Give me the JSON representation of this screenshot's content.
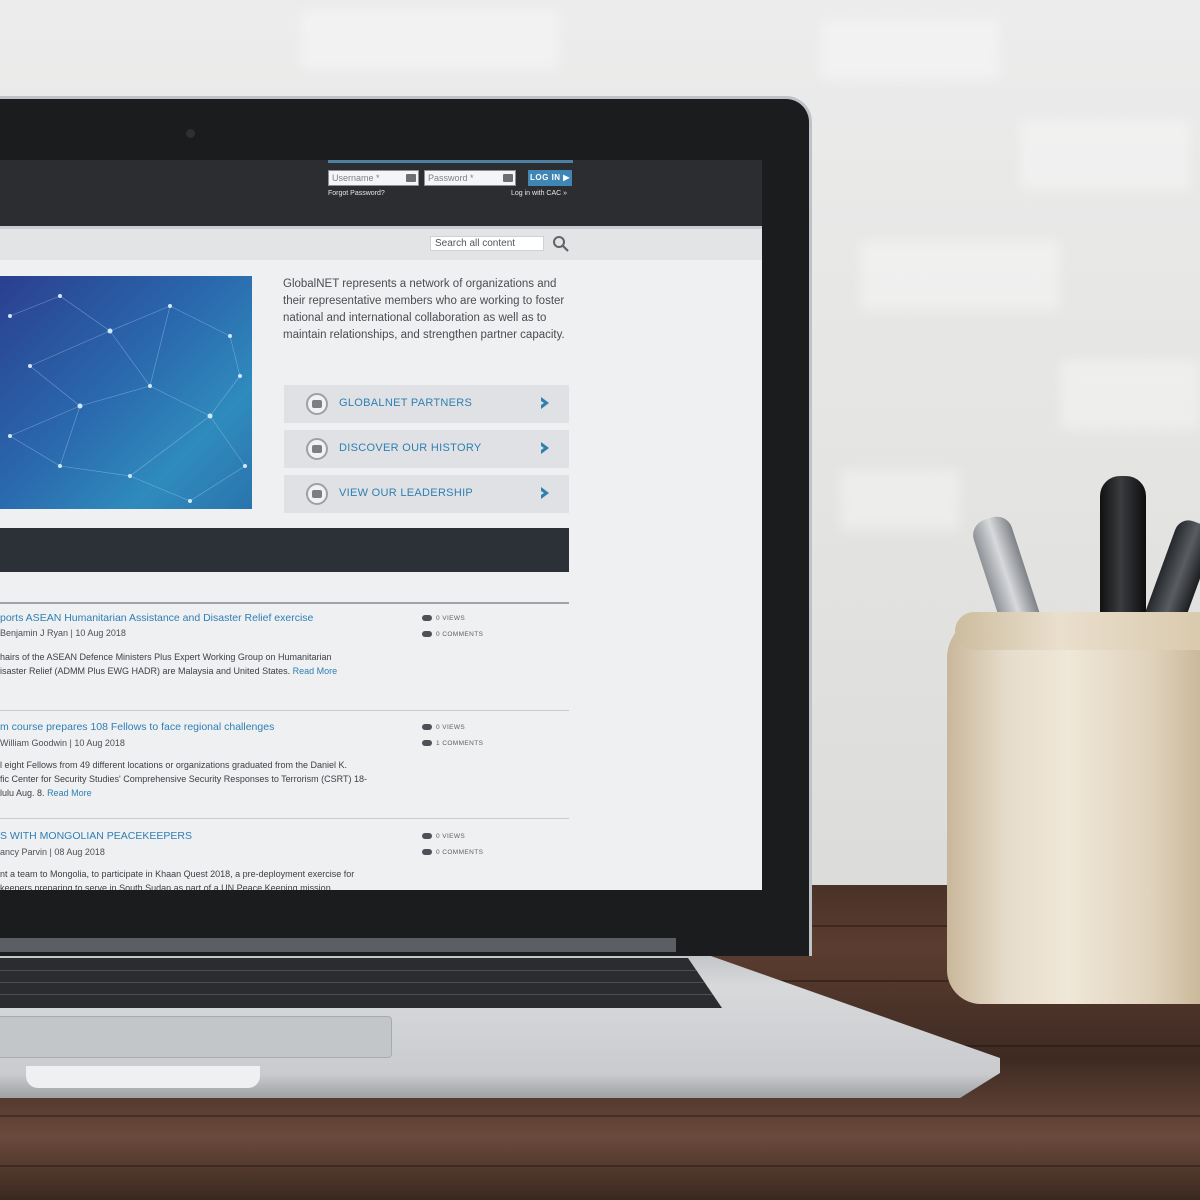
{
  "login": {
    "username_placeholder": "Username *",
    "password_placeholder": "Password *",
    "login_button": "LOG IN ▶",
    "forgot_password": "Forgot Password?",
    "cac_login": "Log in with CAC »"
  },
  "search": {
    "placeholder": "Search all content"
  },
  "intro_text": "GlobalNET represents a network of organizations and their representative members who are working to foster national and international collaboration as well as to maintain relationships, and strengthen partner capacity.",
  "cta_buttons": [
    {
      "label": "GLOBALNET PARTNERS"
    },
    {
      "label": "DISCOVER OUR HISTORY"
    },
    {
      "label": "VIEW OUR LEADERSHIP"
    }
  ],
  "articles": [
    {
      "title": "ports ASEAN Humanitarian Assistance and Disaster Relief exercise",
      "meta": "Benjamin J Ryan | 10 Aug 2018",
      "body_line1": "hairs of the ASEAN Defence Ministers Plus Expert Working Group on Humanitarian",
      "body_line2": "isaster Relief (ADMM Plus EWG HADR) are Malaysia and United States.",
      "read_more": "Read More",
      "views": "0 VIEWS",
      "comments": "0 COMMENTS"
    },
    {
      "title": "m course prepares 108 Fellows to face regional challenges",
      "meta": "William Goodwin | 10 Aug 2018",
      "body_line1": "l eight Fellows from 49 different locations or organizations graduated from the Daniel K.",
      "body_line2": "fic Center for Security Studies' Comprehensive Security Responses to Terrorism (CSRT) 18-",
      "body_line3": "lulu Aug. 8.",
      "read_more": "Read More",
      "views": "0 VIEWS",
      "comments": "1 COMMENTS"
    },
    {
      "title": "S WITH MONGOLIAN PEACEKEEPERS",
      "meta": "ancy Parvin | 08 Aug 2018",
      "body_line1": "nt a team to Mongolia, to participate in Khaan Quest 2018, a pre-deployment exercise for",
      "body_line2": "keepers preparing to serve in South Sudan as part of a UN Peace Keeping mission.",
      "views": "0 VIEWS",
      "comments": "0 COMMENTS"
    }
  ],
  "colors": {
    "accent_blue": "#2f7fb3",
    "login_button": "#3f86b5",
    "topbar": "#2b2d30"
  },
  "icons": [
    "search-icon",
    "chevron-right-icon",
    "seal-icon",
    "eye-icon",
    "comment-icon",
    "input-key-icon"
  ]
}
